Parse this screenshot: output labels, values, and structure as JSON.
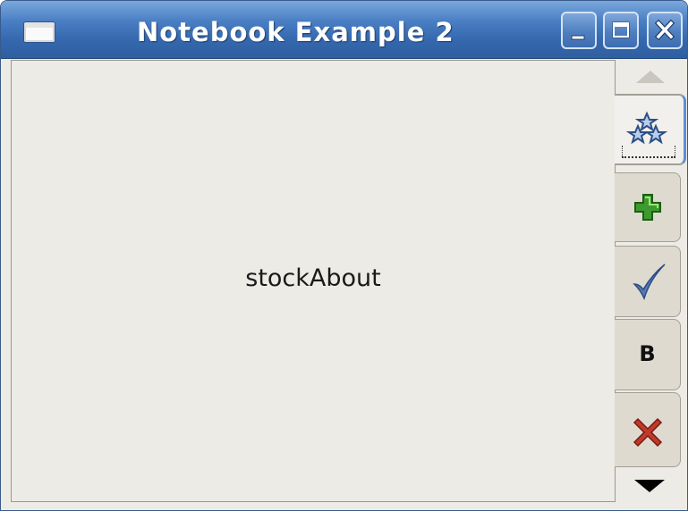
{
  "window": {
    "title": "Notebook Example 2"
  },
  "titlebar_buttons": {
    "minimize_icon": "minimize-icon",
    "maximize_icon": "maximize-icon",
    "close_icon": "close-icon"
  },
  "notebook": {
    "active_page_label": "stockAbout",
    "tabs": [
      {
        "icon": "about-icon",
        "active": true
      },
      {
        "icon": "add-icon",
        "active": false
      },
      {
        "icon": "apply-icon",
        "active": false
      },
      {
        "icon": "bold-icon",
        "glyph": "B",
        "active": false
      },
      {
        "icon": "cancel-icon",
        "active": false
      }
    ],
    "scroll_up_icon": "scroll-up-arrow-icon",
    "scroll_down_icon": "scroll-down-arrow-icon"
  },
  "colors": {
    "titlebar": "#3467ad",
    "background": "#edebe5",
    "focus_tab_accent": "#5b8fd6",
    "add_icon": "#3e9a2e",
    "apply_icon": "#5679b4",
    "cancel_icon": "#c0392b"
  }
}
